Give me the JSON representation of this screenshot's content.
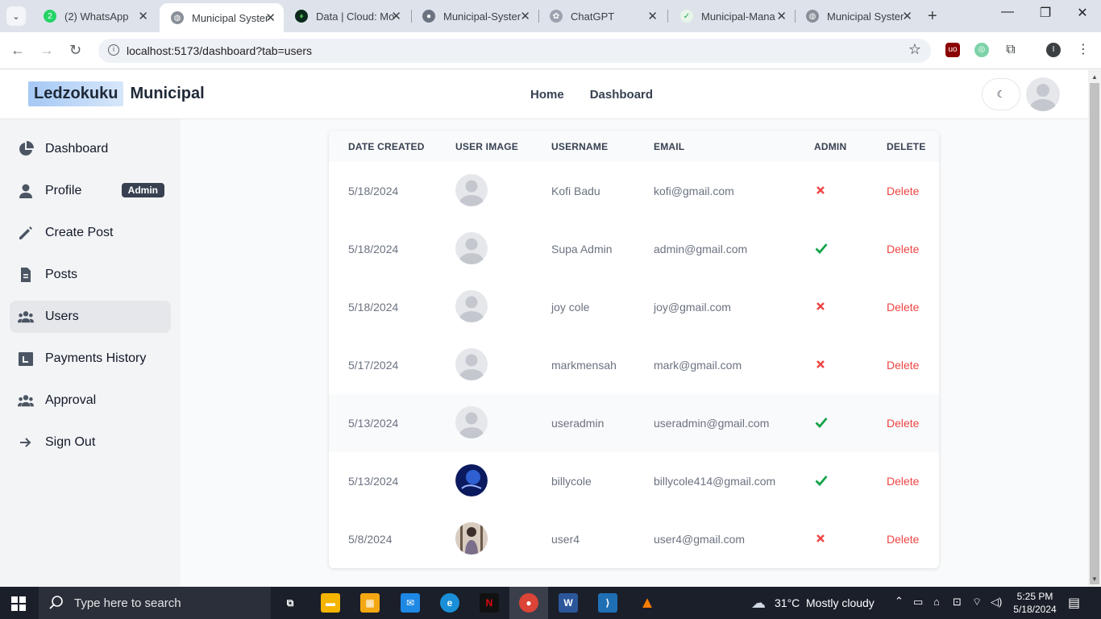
{
  "browser": {
    "tabs": [
      {
        "title": "(2) WhatsApp",
        "icon": "whatsapp-icon"
      },
      {
        "title": "Municipal Syster",
        "icon": "globe-icon",
        "active": true
      },
      {
        "title": "Data | Cloud: Mo",
        "icon": "mongodb-leaf-icon"
      },
      {
        "title": "Municipal-Syster",
        "icon": "github-icon"
      },
      {
        "title": "ChatGPT",
        "icon": "chatgpt-icon"
      },
      {
        "title": "Municipal-Mana",
        "icon": "render-icon"
      },
      {
        "title": "Municipal Syster",
        "icon": "globe-icon"
      }
    ],
    "url": "localhost:5173/dashboard?tab=users",
    "profile_initial": "I"
  },
  "app": {
    "logo_part1": "Ledzokuku",
    "logo_part2": "Municipal",
    "nav": {
      "home": "Home",
      "dashboard": "Dashboard"
    },
    "theme_glyph": "☾"
  },
  "sidebar": {
    "items": [
      {
        "label": "Dashboard",
        "icon": "pie-chart-icon"
      },
      {
        "label": "Profile",
        "icon": "user-icon",
        "badge": "Admin"
      },
      {
        "label": "Create Post",
        "icon": "pencil-icon"
      },
      {
        "label": "Posts",
        "icon": "document-icon"
      },
      {
        "label": "Users",
        "icon": "users-group-icon",
        "active": true
      },
      {
        "label": "Payments History",
        "icon": "calendar-icon"
      },
      {
        "label": "Approval",
        "icon": "users-group-icon"
      },
      {
        "label": "Sign Out",
        "icon": "arrow-right-icon"
      }
    ]
  },
  "table": {
    "headers": [
      "DATE CREATED",
      "USER IMAGE",
      "USERNAME",
      "EMAIL",
      "ADMIN",
      "DELETE"
    ],
    "rows": [
      {
        "date": "5/18/2024",
        "username": "Kofi Badu",
        "email": "kofi@gmail.com",
        "admin": false,
        "delete": "Delete",
        "image": "default"
      },
      {
        "date": "5/18/2024",
        "username": "Supa Admin",
        "email": "admin@gmail.com",
        "admin": true,
        "delete": "Delete",
        "image": "default"
      },
      {
        "date": "5/18/2024",
        "username": "joy cole",
        "email": "joy@gmail.com",
        "admin": false,
        "delete": "Delete",
        "image": "default"
      },
      {
        "date": "5/17/2024",
        "username": "markmensah",
        "email": "mark@gmail.com",
        "admin": false,
        "delete": "Delete",
        "image": "default"
      },
      {
        "date": "5/13/2024",
        "username": "useradmin",
        "email": "useradmin@gmail.com",
        "admin": true,
        "delete": "Delete",
        "image": "default"
      },
      {
        "date": "5/13/2024",
        "username": "billycole",
        "email": "billycole414@gmail.com",
        "admin": true,
        "delete": "Delete",
        "image": "photo-dark-blue"
      },
      {
        "date": "5/8/2024",
        "username": "user4",
        "email": "user4@gmail.com",
        "admin": false,
        "delete": "Delete",
        "image": "photo-person"
      }
    ]
  },
  "colors": {
    "delete": "#ef4444",
    "admin_yes": "#16a34a",
    "admin_no": "#ef4444"
  },
  "taskbar": {
    "search_placeholder": "Type here to search",
    "weather_temp": "31°C",
    "weather_desc": "Mostly cloudy",
    "time": "5:25 PM",
    "date": "5/18/2024"
  }
}
